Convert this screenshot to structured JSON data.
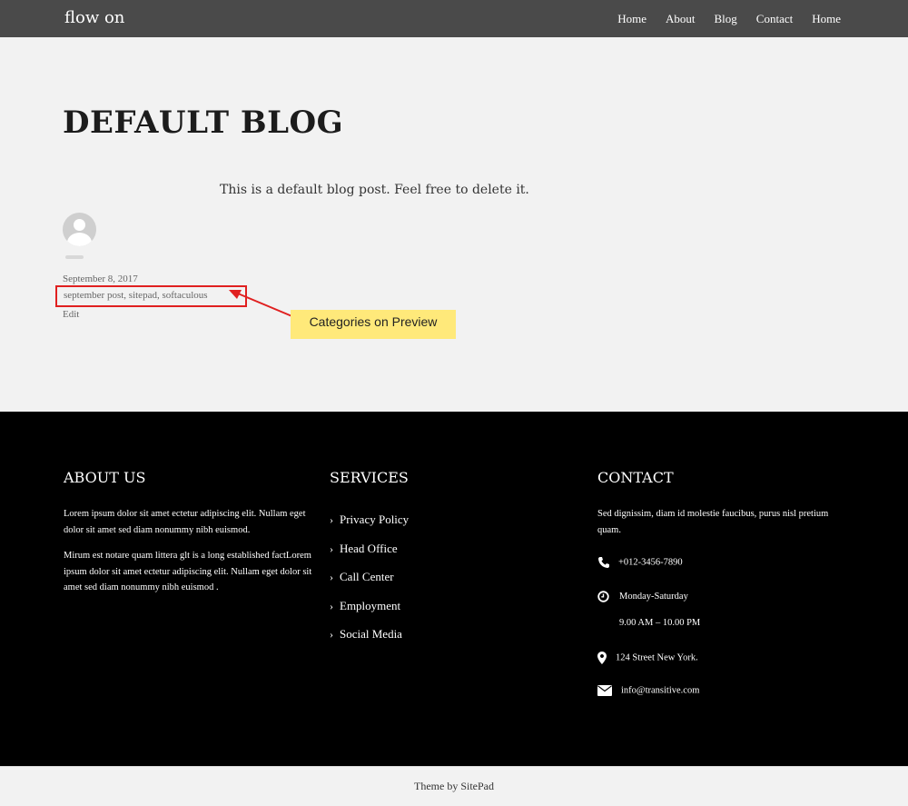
{
  "header": {
    "brand": "flow on",
    "nav": [
      "Home",
      "About",
      "Blog",
      "Contact",
      "Home"
    ]
  },
  "post": {
    "title": "DEFAULT BLOG",
    "body": "This is a default blog post. Feel free to delete it.",
    "date": "September 8, 2017",
    "categories": "september post, sitepad, softaculous",
    "edit": "Edit"
  },
  "annotation": {
    "callout": "Categories on Preview",
    "highlight_color": "#e02020",
    "callout_color": "#ffe97a"
  },
  "footer": {
    "about": {
      "heading": "ABOUT US",
      "para1": "Lorem ipsum dolor sit amet ectetur adipiscing elit. Nullam eget dolor sit amet sed diam nonummy nibh euismod.",
      "para2": "Mirum est notare quam littera glt is a long established factLorem ipsum dolor sit amet ectetur adipiscing elit. Nullam eget dolor sit amet sed diam nonummy nibh euismod ."
    },
    "services": {
      "heading": "SERVICES",
      "items": [
        "Privacy Policy",
        "Head Office",
        "Call Center",
        "Employment",
        "Social Media"
      ]
    },
    "contact": {
      "heading": "CONTACT",
      "intro": "Sed dignissim, diam id molestie faucibus, purus nisl pretium quam.",
      "phone": "+012-3456-7890",
      "days": "Monday-Saturday",
      "hours": "9.00 AM – 10.00 PM",
      "address": "124 Street New York.",
      "email": "info@transitive.com"
    }
  },
  "credit": "Theme by SitePad"
}
